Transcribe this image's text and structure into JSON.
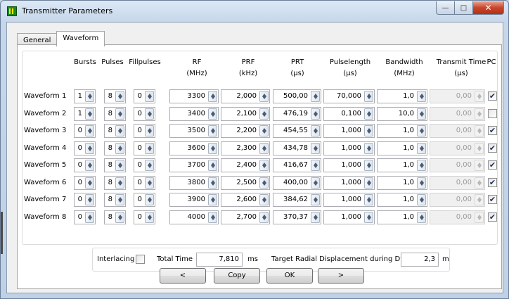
{
  "window": {
    "title": "Transmitter Parameters"
  },
  "tabs": [
    {
      "label": "General"
    },
    {
      "label": "Waveform"
    }
  ],
  "headers": {
    "bursts": "Bursts",
    "pulses": "Pulses",
    "fillpulses": "Fillpulses",
    "rf": "RF",
    "rf_unit": "(MHz)",
    "prf": "PRF",
    "prf_unit": "(kHz)",
    "prt": "PRT",
    "prt_unit": "(µs)",
    "pulselength": "Pulselength",
    "pulselength_unit": "(µs)",
    "bandwidth": "Bandwidth",
    "bandwidth_unit": "(MHz)",
    "transmit_time": "Transmit Time",
    "transmit_time_unit": "(µs)",
    "pc": "PC"
  },
  "rows": [
    {
      "label": "Waveform 1",
      "bursts": "1",
      "pulses": "8",
      "fillpulses": "0",
      "rf": "3300",
      "prf": "2,000",
      "prt": "500,00",
      "pulselength": "70,000",
      "bandwidth": "1,0",
      "transmit_time": "0,00",
      "pc": true
    },
    {
      "label": "Waveform 2",
      "bursts": "1",
      "pulses": "8",
      "fillpulses": "0",
      "rf": "3400",
      "prf": "2,100",
      "prt": "476,19",
      "pulselength": "0,100",
      "bandwidth": "10,0",
      "transmit_time": "0,00",
      "pc": false
    },
    {
      "label": "Waveform 3",
      "bursts": "0",
      "pulses": "8",
      "fillpulses": "0",
      "rf": "3500",
      "prf": "2,200",
      "prt": "454,55",
      "pulselength": "1,000",
      "bandwidth": "1,0",
      "transmit_time": "0,00",
      "pc": true
    },
    {
      "label": "Waveform 4",
      "bursts": "0",
      "pulses": "8",
      "fillpulses": "0",
      "rf": "3600",
      "prf": "2,300",
      "prt": "434,78",
      "pulselength": "1,000",
      "bandwidth": "1,0",
      "transmit_time": "0,00",
      "pc": true
    },
    {
      "label": "Waveform 5",
      "bursts": "0",
      "pulses": "8",
      "fillpulses": "0",
      "rf": "3700",
      "prf": "2,400",
      "prt": "416,67",
      "pulselength": "1,000",
      "bandwidth": "1,0",
      "transmit_time": "0,00",
      "pc": true
    },
    {
      "label": "Waveform 6",
      "bursts": "0",
      "pulses": "8",
      "fillpulses": "0",
      "rf": "3800",
      "prf": "2,500",
      "prt": "400,00",
      "pulselength": "1,000",
      "bandwidth": "1,0",
      "transmit_time": "0,00",
      "pc": true
    },
    {
      "label": "Waveform 7",
      "bursts": "0",
      "pulses": "8",
      "fillpulses": "0",
      "rf": "3900",
      "prf": "2,600",
      "prt": "384,62",
      "pulselength": "1,000",
      "bandwidth": "1,0",
      "transmit_time": "0,00",
      "pc": true
    },
    {
      "label": "Waveform 8",
      "bursts": "0",
      "pulses": "8",
      "fillpulses": "0",
      "rf": "4000",
      "prf": "2,700",
      "prt": "370,37",
      "pulselength": "1,000",
      "bandwidth": "1,0",
      "transmit_time": "0,00",
      "pc": true
    }
  ],
  "options": {
    "interlacing_label": "Interlacing",
    "interlacing_checked": false,
    "total_time_label": "Total Time",
    "total_time_value": "7,810",
    "total_time_unit": "ms",
    "displacement_label": "Target Radial Displacement during Dwell",
    "displacement_value": "2,3",
    "displacement_unit": "m"
  },
  "buttons": {
    "prev": "<",
    "copy": "Copy",
    "ok": "OK",
    "next": ">"
  },
  "colors": {
    "accent": "#1c8a1c",
    "close": "#c7452b",
    "check": "#232c5e"
  }
}
